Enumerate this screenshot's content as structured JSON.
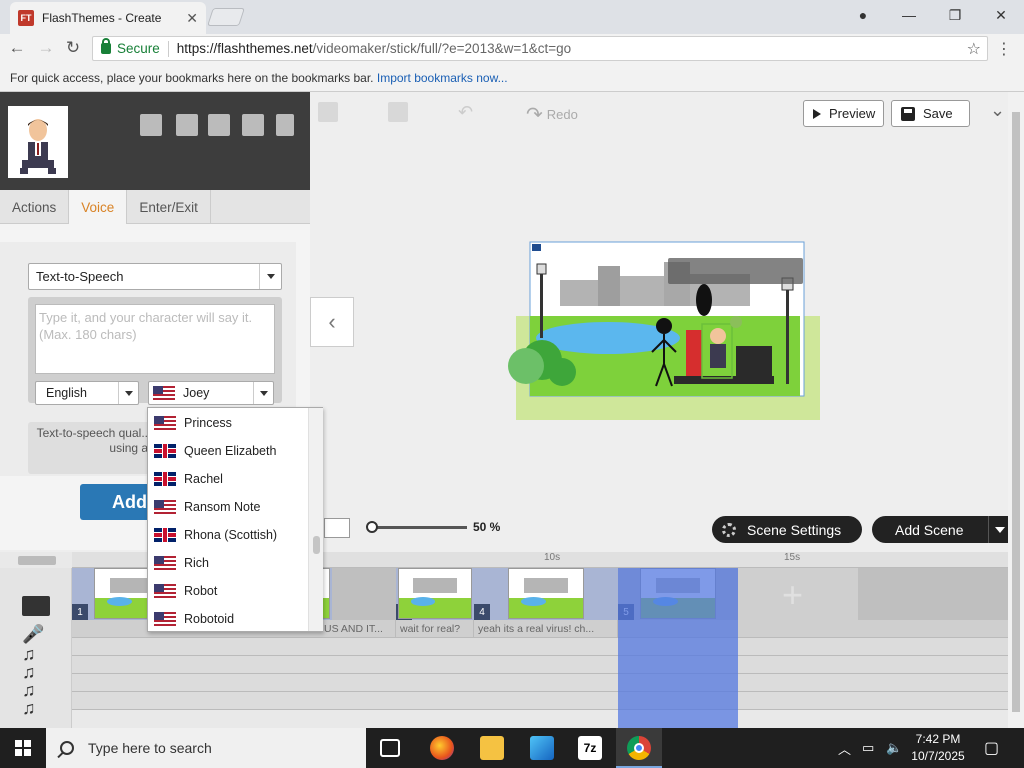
{
  "browser": {
    "tab_title": "FlashThemes - Create",
    "tab_favicon": "FT",
    "secure_label": "Secure",
    "url_host": "https://flashthemes.net",
    "url_path": "/videomaker/stick/full/?e=2013&w=1&ct=go",
    "bookmarks_hint": "For quick access, place your bookmarks here on the bookmarks bar.",
    "bookmarks_link": "Import bookmarks now..."
  },
  "toolbar": {
    "redo_label": "Redo",
    "preview_label": "Preview",
    "save_label": "Save"
  },
  "panel": {
    "tabs": [
      {
        "label": "Actions"
      },
      {
        "label": "Voice"
      },
      {
        "label": "Enter/Exit"
      }
    ],
    "voice_mode": "Text-to-Speech",
    "textarea_placeholder": "Type it, and your character will say it.  (Max.  180 chars)",
    "language": "English",
    "voice": "Joey",
    "notice": "Text-to-speech qual... placeholder. For you... using a better v...",
    "add_label": "Add"
  },
  "voice_list": [
    {
      "name": "Princess",
      "flag": "us"
    },
    {
      "name": "Queen Elizabeth",
      "flag": "uk"
    },
    {
      "name": "Rachel",
      "flag": "uk"
    },
    {
      "name": "Ransom Note",
      "flag": "us"
    },
    {
      "name": "Rhona (Scottish)",
      "flag": "uk"
    },
    {
      "name": "Rich",
      "flag": "us"
    },
    {
      "name": "Robot",
      "flag": "us"
    },
    {
      "name": "Robotoid",
      "flag": "us"
    }
  ],
  "stage": {
    "zoom": "50 %",
    "scene_settings_label": "Scene Settings",
    "add_scene_label": "Add Scene"
  },
  "timeline": {
    "ruler": [
      "10s",
      "15s"
    ],
    "scenes": [
      "1",
      "3",
      "4",
      "5"
    ],
    "voice_clips": [
      "US AND IT...",
      "wait for real?",
      "yeah its a real virus! ch..."
    ]
  },
  "taskbar": {
    "search_placeholder": "Type here to search",
    "time": "7:42 PM",
    "date": "10/7/2025",
    "zip_label": "7z"
  },
  "colors": {
    "accent_tab": "#d98326",
    "add_button": "#2a78b5",
    "selected_scene": "#5478e0",
    "secure_green": "#188038"
  }
}
